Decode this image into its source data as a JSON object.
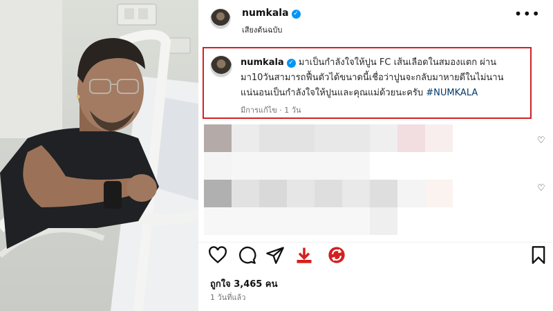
{
  "post": {
    "username": "numkala",
    "audio": "เสียงต้นฉบับ",
    "caption_line1": "มาเป็นกำลังใจให้ปูน FC เส้นเลือดในสมองแตก ผ่าน",
    "caption_line2": "มา10วันสามารถฟื้นตัวได้ขนาดนี้เชื่อว่าปูนจะกลับมาหายดีในไม่นาน",
    "caption_line3": "แน่นอนเป็นกำลังใจให้ปูนและคุณแม่ด้วยนะครับ",
    "hashtag": "#NUMKALA",
    "caption_meta": "มีการแก้ไข · 1 วัน",
    "likes": "ถูกใจ 3,465 คน",
    "time_ago": "1 วันที่แล้ว"
  },
  "icons": {
    "verified": "✓",
    "more": "•••"
  },
  "colors": {
    "highlight_border": "#d3201f",
    "verified_badge": "#0095f6",
    "share_accent": "#d3201f",
    "hashtag": "#00376b"
  }
}
